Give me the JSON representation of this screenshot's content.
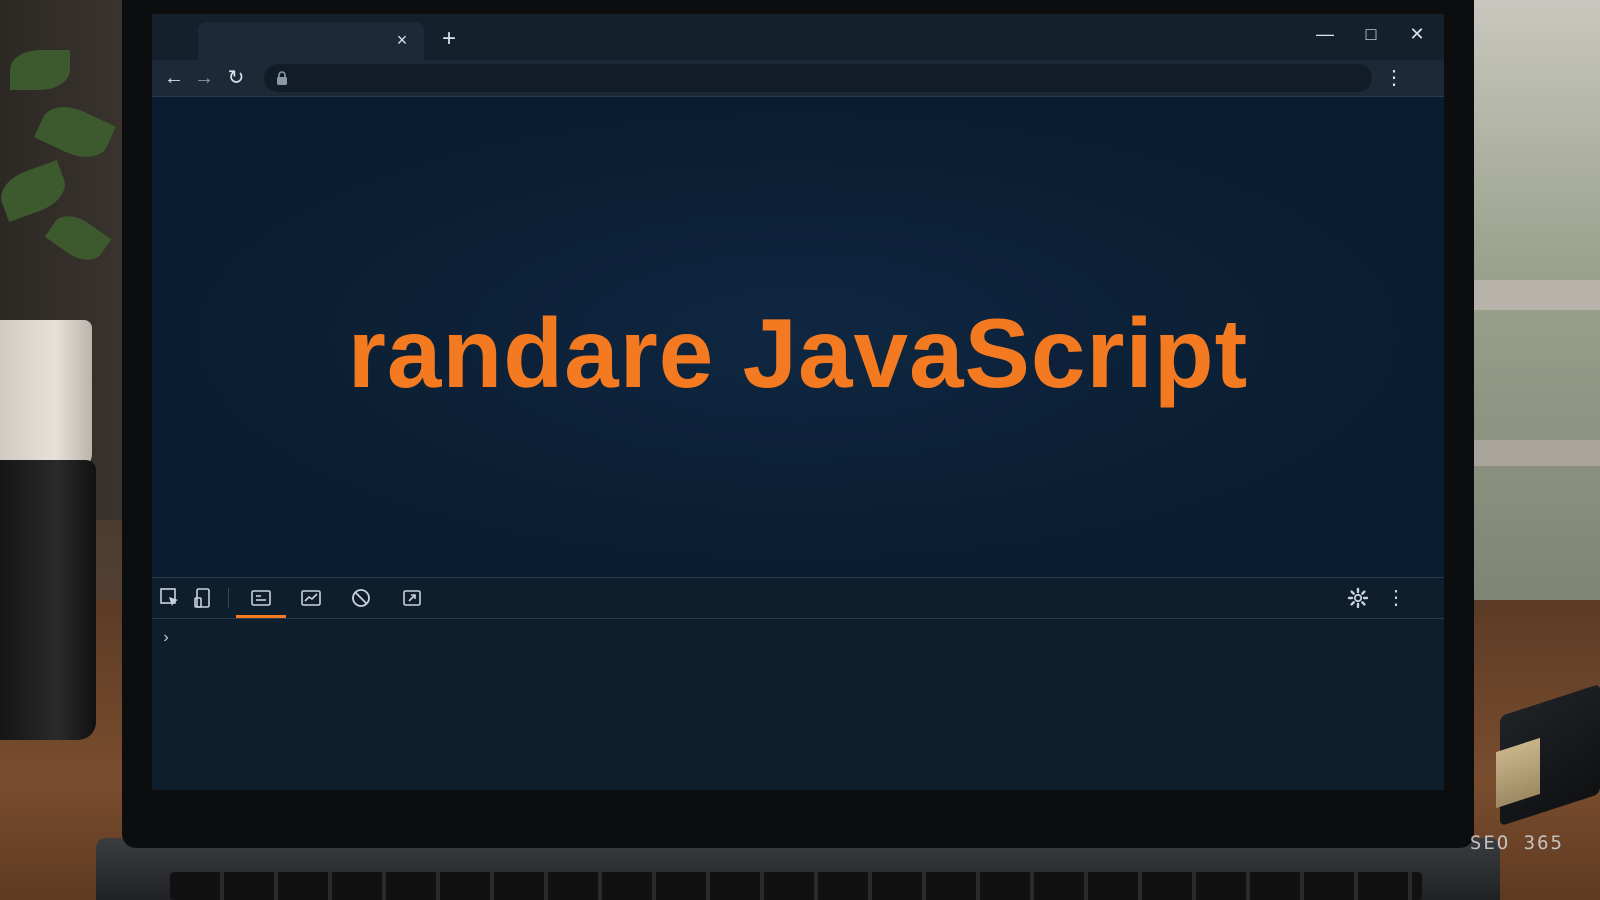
{
  "browser": {
    "tab_title": "",
    "close_tab_glyph": "×",
    "new_tab_glyph": "+",
    "window_controls": {
      "minimize": "—",
      "maximize": "□",
      "close": "✕"
    },
    "nav": {
      "back": "←",
      "forward": "→",
      "reload": "↻"
    },
    "address": "",
    "menu_glyph": "⋮"
  },
  "page": {
    "hero_text": "randare JavaScript",
    "hero_color": "#f47a22",
    "background": "#0d1f33"
  },
  "devtools": {
    "tools": [
      "select-element-icon",
      "device-toggle-icon",
      "console-icon",
      "performance-icon",
      "clear-icon",
      "screenshot-icon"
    ],
    "active_tool": "console-icon",
    "prompt_glyph": "›",
    "console_input": "",
    "settings_icon": "gear-icon",
    "menu_glyph": "⋮"
  },
  "watermark": "SEO 365"
}
